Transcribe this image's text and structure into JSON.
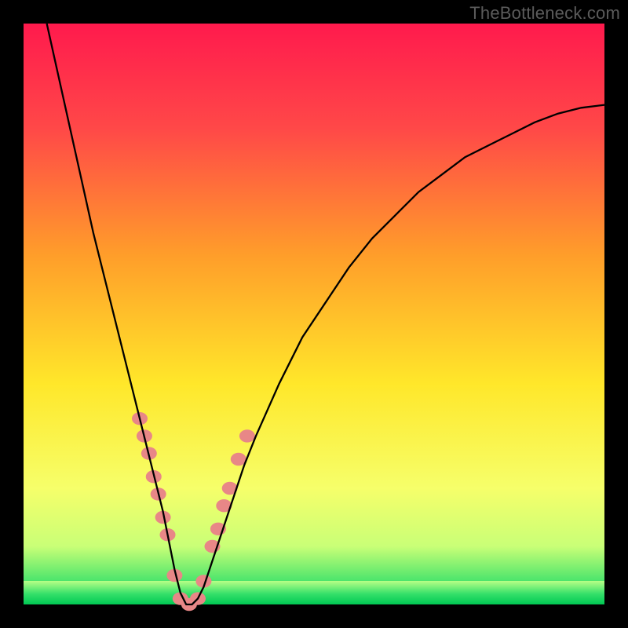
{
  "watermark": {
    "text": "TheBottleneck.com"
  },
  "chart_data": {
    "type": "line",
    "title": "",
    "xlabel": "",
    "ylabel": "",
    "xlim": [
      0,
      100
    ],
    "ylim": [
      0,
      100
    ],
    "gradient_stops": [
      {
        "pct": 0,
        "color": "#ff1a4d"
      },
      {
        "pct": 18,
        "color": "#ff4848"
      },
      {
        "pct": 40,
        "color": "#ff9e2a"
      },
      {
        "pct": 62,
        "color": "#ffe72a"
      },
      {
        "pct": 80,
        "color": "#f6ff6a"
      },
      {
        "pct": 90,
        "color": "#c9ff77"
      },
      {
        "pct": 97,
        "color": "#35e06a"
      },
      {
        "pct": 100,
        "color": "#00c853"
      }
    ],
    "green_band": {
      "y_from": 0,
      "y_to": 4
    },
    "series": [
      {
        "name": "bottleneck-curve",
        "color": "#000000",
        "width": 2.3,
        "x": [
          4,
          6,
          8,
          10,
          12,
          14,
          16,
          18,
          20,
          21,
          22,
          23,
          24,
          25,
          26,
          27,
          28,
          29,
          30,
          31,
          32,
          34,
          36,
          38,
          40,
          44,
          48,
          52,
          56,
          60,
          64,
          68,
          72,
          76,
          80,
          84,
          88,
          92,
          96,
          100
        ],
        "y": [
          100,
          91,
          82,
          73,
          64,
          56,
          48,
          40,
          32,
          28,
          24,
          20,
          16,
          11,
          6,
          2,
          0,
          0,
          1,
          3,
          6,
          12,
          18,
          24,
          29,
          38,
          46,
          52,
          58,
          63,
          67,
          71,
          74,
          77,
          79,
          81,
          83,
          84.5,
          85.5,
          86
        ]
      }
    ],
    "markers": {
      "name": "highlight-dots",
      "color": "#e88787",
      "radius": 10,
      "points": [
        {
          "x": 20.0,
          "y": 32
        },
        {
          "x": 20.8,
          "y": 29
        },
        {
          "x": 21.6,
          "y": 26
        },
        {
          "x": 22.4,
          "y": 22
        },
        {
          "x": 23.2,
          "y": 19
        },
        {
          "x": 24.0,
          "y": 15
        },
        {
          "x": 24.8,
          "y": 12
        },
        {
          "x": 26.0,
          "y": 5
        },
        {
          "x": 27.0,
          "y": 1
        },
        {
          "x": 28.5,
          "y": 0
        },
        {
          "x": 30.0,
          "y": 1
        },
        {
          "x": 31.0,
          "y": 4
        },
        {
          "x": 32.5,
          "y": 10
        },
        {
          "x": 33.5,
          "y": 13
        },
        {
          "x": 34.5,
          "y": 17
        },
        {
          "x": 35.5,
          "y": 20
        },
        {
          "x": 37.0,
          "y": 25
        },
        {
          "x": 38.5,
          "y": 29
        }
      ]
    }
  }
}
